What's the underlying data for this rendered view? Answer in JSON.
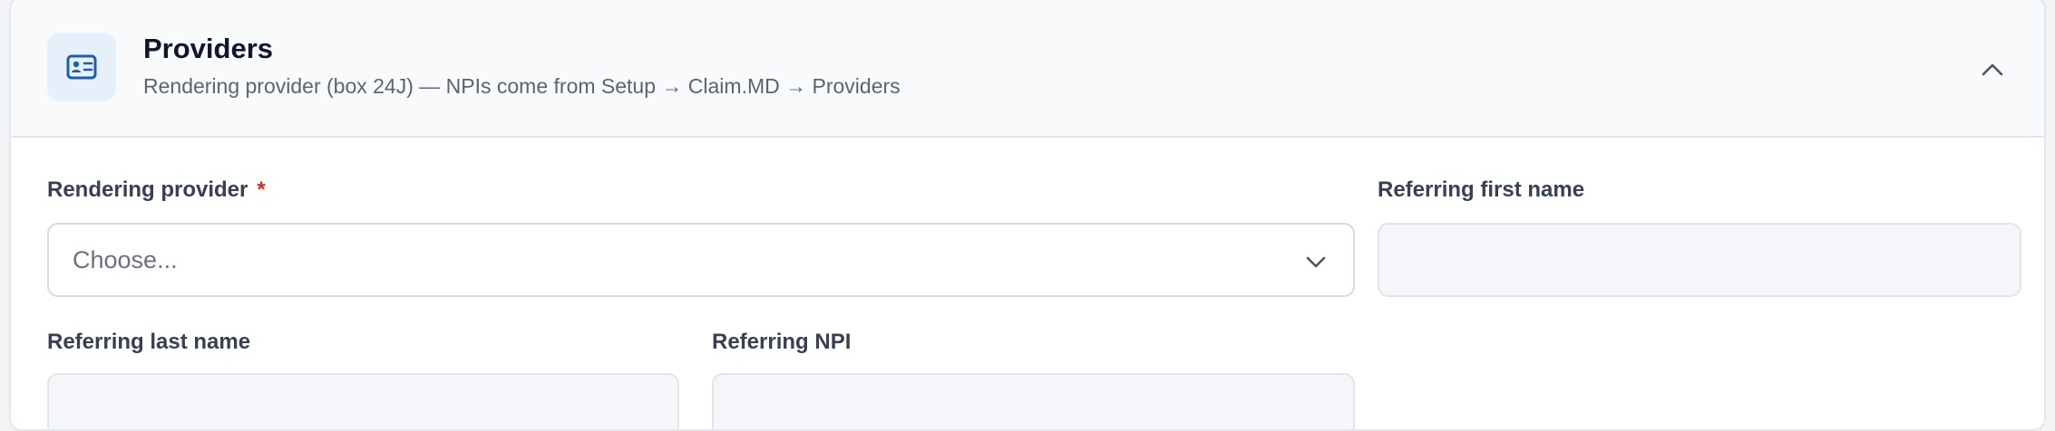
{
  "section": {
    "icon": "contact-card-icon",
    "title": "Providers",
    "subtitle": "Rendering provider (box 24J) — NPIs come from Setup → Claim.MD → Providers",
    "collapse_icon": "chevron-up-icon"
  },
  "fields": {
    "rendering_provider": {
      "label": "Rendering provider",
      "required_marker": "*",
      "value": "Choose...",
      "icon": "chevron-down-icon"
    },
    "referring_first_name": {
      "label": "Referring first name",
      "value": "",
      "placeholder": ""
    },
    "referring_last_name": {
      "label": "Referring last name",
      "value": "",
      "placeholder": ""
    },
    "referring_npi": {
      "label": "Referring NPI",
      "value": "",
      "placeholder": ""
    }
  },
  "colors": {
    "accent": "#1d5fa8",
    "required": "#dc2626",
    "icon_background": "#e6f0fb"
  }
}
